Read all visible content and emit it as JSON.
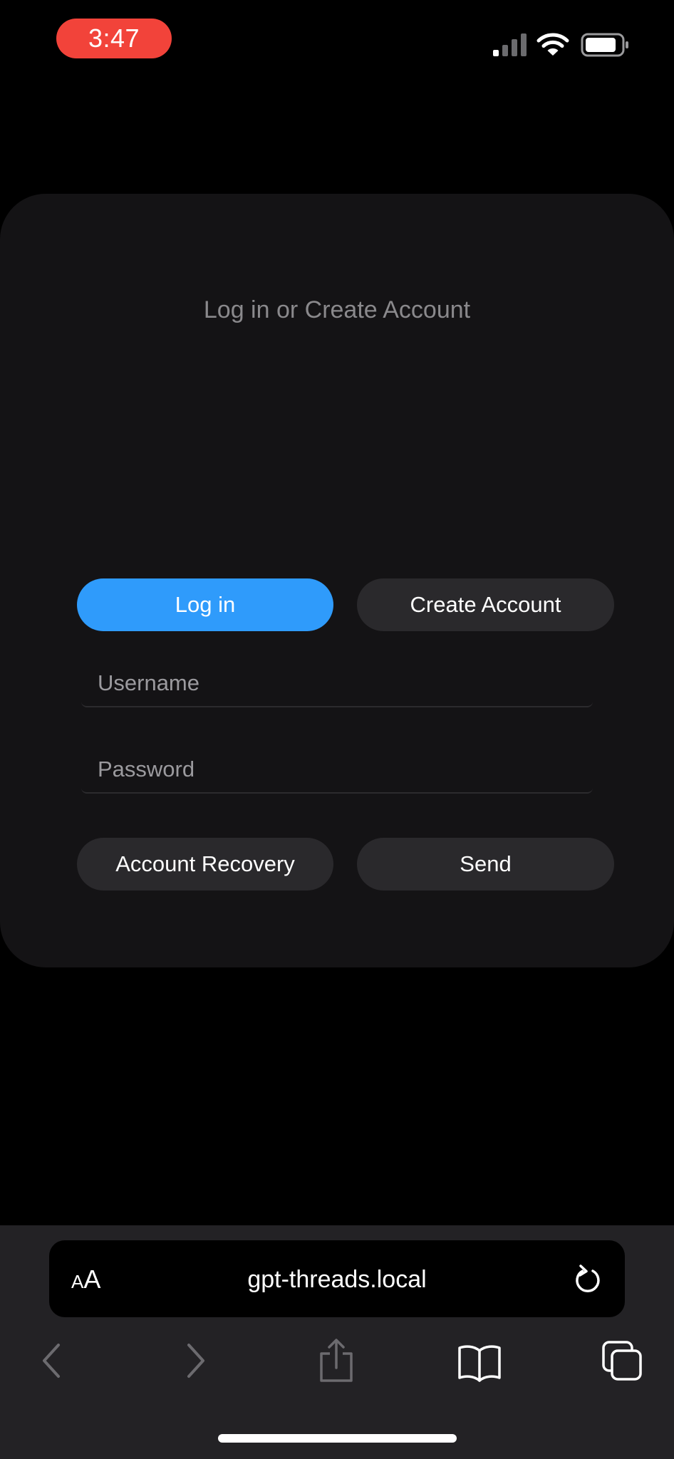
{
  "status_bar": {
    "time": "3:47",
    "icons": [
      "cellular-signal-icon",
      "wifi-icon",
      "battery-icon"
    ]
  },
  "card": {
    "title": "Log in or Create Account",
    "login_label": "Log in",
    "create_account_label": "Create Account",
    "username_placeholder": "Username",
    "password_placeholder": "Password",
    "recovery_label": "Account Recovery",
    "send_label": "Send"
  },
  "browser": {
    "text_size_small": "A",
    "text_size_large": "A",
    "url": "gpt-threads.local",
    "toolbar_icons": [
      "back-icon",
      "forward-icon",
      "share-icon",
      "bookmarks-icon",
      "tabs-icon"
    ]
  },
  "colors": {
    "background": "#000000",
    "card": "#141315",
    "accent": "#2f9bfb",
    "time_pill": "#f2433a",
    "button": "#2a292c",
    "toolbar": "#232225"
  }
}
